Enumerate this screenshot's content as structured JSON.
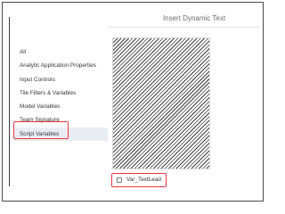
{
  "dialog": {
    "title": "Insert Dynamic Text"
  },
  "sidebar": {
    "items": [
      {
        "label": "All"
      },
      {
        "label": "Analytic Application Properties"
      },
      {
        "label": "Input Controls"
      },
      {
        "label": "Tile Filters & Variables"
      },
      {
        "label": "Model Variables"
      },
      {
        "label": "Team Signature"
      },
      {
        "label": "Script Variables",
        "selected": true
      }
    ]
  },
  "variables": [
    {
      "label": "Var_TextLead",
      "checked": false
    }
  ],
  "colors": {
    "highlight_outline": "#e8383d",
    "selected_bg": "#e8edf3"
  }
}
